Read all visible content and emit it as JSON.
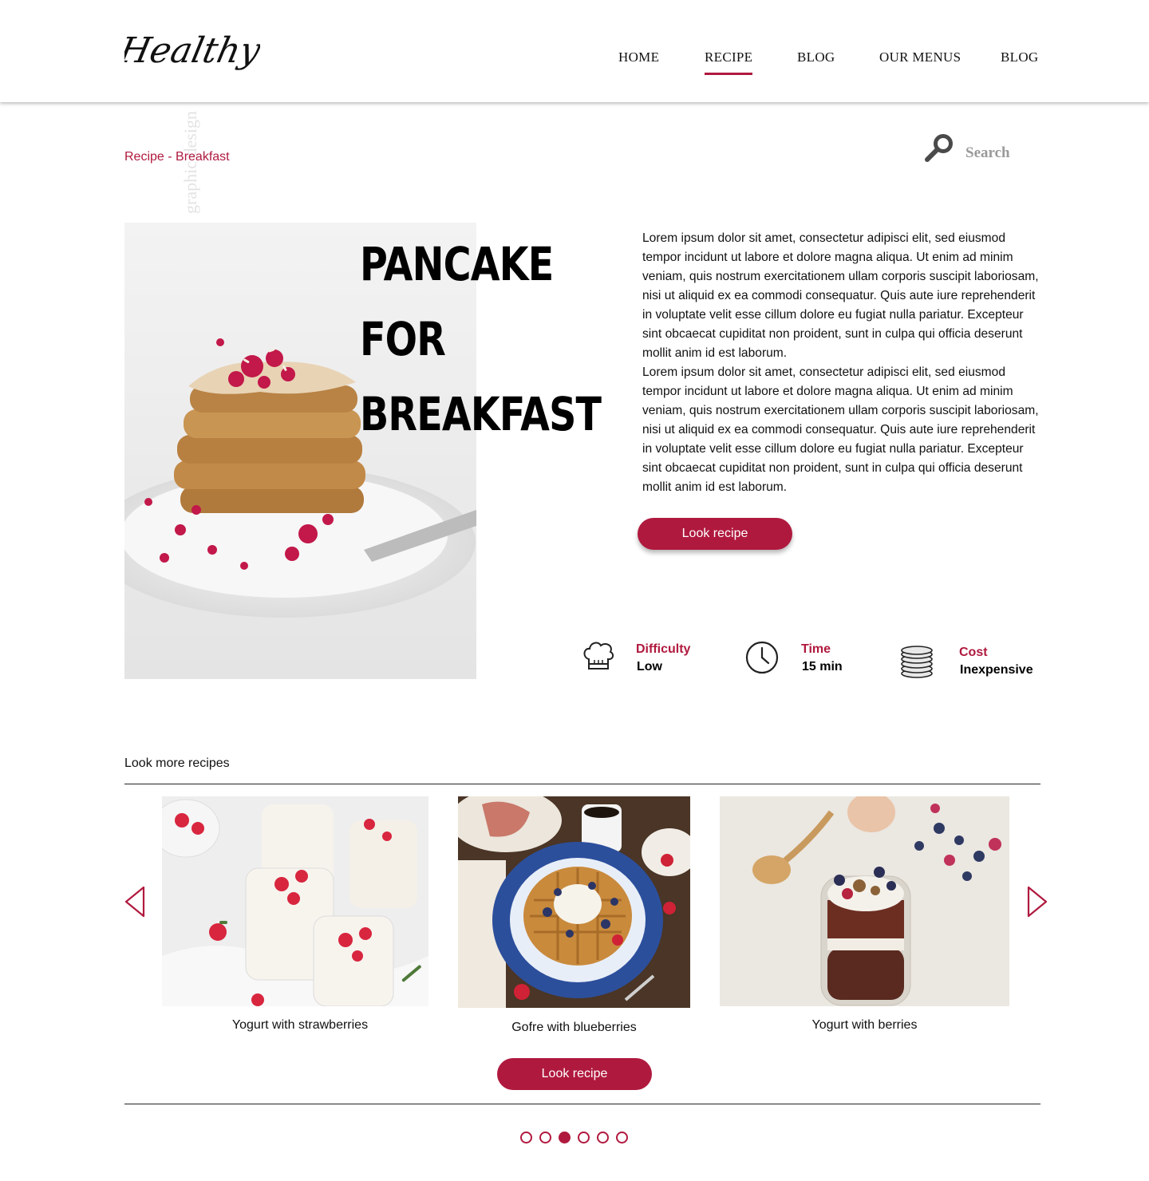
{
  "header": {
    "logo_text": "Healthy",
    "nav": [
      {
        "label": "HOME"
      },
      {
        "label": "RECIPE",
        "active": true
      },
      {
        "label": "BLOG"
      },
      {
        "label": "OUR MENUS"
      },
      {
        "label": "BLOG"
      }
    ]
  },
  "breadcrumb": "Recipe - Breakfast",
  "watermark_text": "graphic design",
  "search": {
    "label": "Search",
    "icon": "search-icon"
  },
  "hero": {
    "title_lines": [
      "PANCAKE",
      "FOR",
      "BREAKFAST"
    ],
    "paragraphs": [
      "Lorem ipsum dolor sit amet, consectetur adipisci elit, sed eiusmod tempor incidunt ut labore et dolore magna aliqua. Ut enim ad minim veniam, quis nostrum exercitationem ullam corporis suscipit laboriosam, nisi ut aliquid ex ea commodi consequatur. Quis aute iure reprehenderit in voluptate velit esse cillum dolore eu fugiat nulla pariatur. Excepteur sint obcaecat cupiditat non proident, sunt in culpa qui officia deserunt mollit anim id est laborum.",
      "Lorem ipsum dolor sit amet, consectetur adipisci elit, sed eiusmod tempor incidunt ut labore et dolore magna aliqua. Ut enim ad minim veniam, quis nostrum exercitationem ullam corporis suscipit laboriosam, nisi ut aliquid ex ea commodi consequatur. Quis aute iure reprehenderit in voluptate velit esse cillum dolore eu fugiat nulla pariatur. Excepteur sint obcaecat cupiditat non proident, sunt in culpa qui officia deserunt mollit anim id est laborum."
    ],
    "button_label": "Look recipe",
    "image": "pancake stack with raspberries"
  },
  "stats": [
    {
      "label": "Difficulty",
      "value": "Low",
      "icon": "chef-hat-icon"
    },
    {
      "label": "Time",
      "value": "15 min",
      "icon": "clock-icon"
    },
    {
      "label": "Cost",
      "value": "Inexpensive",
      "icon": "coins-icon"
    }
  ],
  "more": {
    "title": "Look more recipes",
    "cards": [
      {
        "caption": "Yogurt with strawberries"
      },
      {
        "caption": "Gofre with blueberries"
      },
      {
        "caption": "Yogurt with berries"
      }
    ],
    "button_label": "Look recipe",
    "pagination": {
      "count": 6,
      "active_index": 2
    }
  },
  "colors": {
    "accent": "#b0193e",
    "text": "#111111",
    "muted": "#9a9a9a"
  }
}
